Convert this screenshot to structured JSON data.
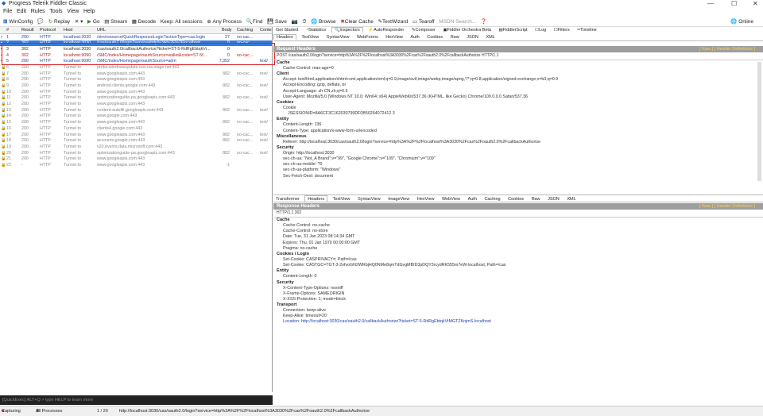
{
  "window": {
    "title": "Progress Telerik Fiddler Classic"
  },
  "menu": [
    "File",
    "Edit",
    "Rules",
    "Tools",
    "View",
    "Help"
  ],
  "toolbar": {
    "winconfig": "WinConfig",
    "replay": "Replay",
    "go": "Go",
    "stream": "Stream",
    "decode": "Decode",
    "keep": "Keep: All sessions",
    "anyprocess": "Any Process",
    "find": "Find",
    "save": "Save",
    "browse": "Browse",
    "clearcache": "Clear Cache",
    "textwizard": "TextWizard",
    "tearoff": "Tearoff",
    "msdn": "MSDN Search...",
    "online": "Online"
  },
  "columns": [
    "#",
    "Result",
    "Protocol",
    "Host",
    "URL",
    "Body",
    "Caching",
    "Conte"
  ],
  "sessions": [
    {
      "id": "1",
      "result": "200",
      "protocol": "HTTP",
      "host": "localhost:3030",
      "url": "/sim/resource/QuickResponseLogin?actionType=cas.login",
      "body": "27",
      "caching": "no-cac...",
      "content": "",
      "style": "blue"
    },
    {
      "id": "2",
      "result": "302",
      "protocol": "HTTP",
      "host": "localhost:3030",
      "url": "/cas/oauth2.0/login?service=http%3A%2F%2Flocalhost...",
      "body": "0",
      "caching": "no-cac...",
      "content": "",
      "style": "sel"
    },
    {
      "id": "3",
      "result": "302",
      "protocol": "HTTP",
      "host": "localhost:3030",
      "url": "/cas/oauth2.0/callbackAuthorize?ticket=ST-5-RdRgEbtqkVr...",
      "body": "0",
      "caching": "",
      "content": "",
      "style": ""
    },
    {
      "id": "4",
      "result": "302",
      "protocol": "HTTP",
      "host": "localhost:9090",
      "url": "/SMC/index/Homepage/oauthSource=wallet&code=ST-5f...",
      "body": "0",
      "caching": "no-cac...",
      "content": "",
      "style": "red"
    },
    {
      "id": "5",
      "result": "200",
      "protocol": "HTTP",
      "host": "localhost:9090",
      "url": "/SMC/index/Homepage/oauthSource=adm",
      "body": "7,352",
      "caching": "",
      "content": "text/",
      "style": "blue"
    },
    {
      "id": "6",
      "result": "200",
      "protocol": "HTTP",
      "host": "Tunnel to",
      "url": "probe.windowsupdate.nos.rav.stage.net:443",
      "body": "",
      "caching": "",
      "content": "",
      "style": "gray"
    },
    {
      "id": "7",
      "result": "200",
      "protocol": "HTTP",
      "host": "Tunnel to",
      "url": "www.googleapis.com:443",
      "body": "882",
      "caching": "no-cac...",
      "content": "text/",
      "style": "gray"
    },
    {
      "id": "8",
      "result": "200",
      "protocol": "HTTP",
      "host": "Tunnel to",
      "url": "www.googleapis.com:443",
      "body": "",
      "caching": "",
      "content": "",
      "style": "gray"
    },
    {
      "id": "9",
      "result": "200",
      "protocol": "HTTP",
      "host": "Tunnel to",
      "url": "android.clients.google.com:443",
      "body": "882",
      "caching": "no-cac...",
      "content": "text/",
      "style": "gray"
    },
    {
      "id": "10",
      "result": "200",
      "protocol": "HTTP",
      "host": "Tunnel to",
      "url": "www.googleapis.com:443",
      "body": "",
      "caching": "",
      "content": "",
      "style": "gray"
    },
    {
      "id": "11",
      "result": "200",
      "protocol": "HTTP",
      "host": "Tunnel to",
      "url": "optimizationguide-pa.googleapis.com:443",
      "body": "882",
      "caching": "no-cac...",
      "content": "text/",
      "style": "gray"
    },
    {
      "id": "12",
      "result": "200",
      "protocol": "HTTP",
      "host": "Tunnel to",
      "url": "www.googleapis.com:443",
      "body": "",
      "caching": "",
      "content": "",
      "style": "gray"
    },
    {
      "id": "13",
      "result": "200",
      "protocol": "HTTP",
      "host": "Tunnel to",
      "url": "content-autofill.googleapis.com:443",
      "body": "882",
      "caching": "no-cac...",
      "content": "text/",
      "style": "gray"
    },
    {
      "id": "14",
      "result": "200",
      "protocol": "HTTP",
      "host": "Tunnel to",
      "url": "www.google.com:443",
      "body": "",
      "caching": "",
      "content": "",
      "style": "gray"
    },
    {
      "id": "15",
      "result": "200",
      "protocol": "HTTP",
      "host": "Tunnel to",
      "url": "www.googleapis.com:443",
      "body": "882",
      "caching": "no-cac...",
      "content": "text/",
      "style": "gray"
    },
    {
      "id": "16",
      "result": "200",
      "protocol": "HTTP",
      "host": "Tunnel to",
      "url": "clients4.google.com:443",
      "body": "",
      "caching": "",
      "content": "",
      "style": "gray"
    },
    {
      "id": "17",
      "result": "200",
      "protocol": "HTTP",
      "host": "Tunnel to",
      "url": "www.googleapis.com:443",
      "body": "882",
      "caching": "no-cac...",
      "content": "text/",
      "style": "gray"
    },
    {
      "id": "18",
      "result": "200",
      "protocol": "HTTP",
      "host": "Tunnel to",
      "url": "accounts.google.com:443",
      "body": "882",
      "caching": "no-cac...",
      "content": "text/",
      "style": "gray"
    },
    {
      "id": "19",
      "result": "200",
      "protocol": "HTTP",
      "host": "Tunnel to",
      "url": "v20.events.data.microsoft.com:443",
      "body": "",
      "caching": "",
      "content": "",
      "style": "gray"
    },
    {
      "id": "20",
      "result": "200",
      "protocol": "HTTP",
      "host": "Tunnel to",
      "url": "optimizationguide-pa.googleapis.com:443",
      "body": "882",
      "caching": "no-cac...",
      "content": "text/",
      "style": "gray"
    },
    {
      "id": "21",
      "result": "200",
      "protocol": "HTTP",
      "host": "Tunnel to",
      "url": "www.googleapis.com:443",
      "body": "",
      "caching": "",
      "content": "",
      "style": "gray"
    },
    {
      "id": "22",
      "result": "-",
      "protocol": "HTTP",
      "host": "Tunnel to",
      "url": "www.googleapis.com:443",
      "body": "-1",
      "caching": "",
      "content": "",
      "style": "gray"
    }
  ],
  "quickexec": "[QuickExec] ALT+Q > type HELP to learn more",
  "status": {
    "capturing": "Capturing",
    "processes": "All Processes",
    "count": "1 / 20",
    "url": "http://localhost:3030/cas/oauth2.0/login?service=http%3A%2F%2Flocalhost%3A3030%2Fcas%2Foauth2.0%2FcallbackAuthorize"
  },
  "tabs_top": [
    "Get Started",
    "Statistics",
    "Inspectors",
    "AutoResponder",
    "Composer",
    "Fiddler Orchestra Beta",
    "FiddlerScript",
    "Log",
    "Filters",
    "Timeline"
  ],
  "tabs_req": [
    "Headers",
    "TextView",
    "SyntaxView",
    "WebForms",
    "HexView",
    "Auth",
    "Cookies",
    "Raw",
    "JSON",
    "XML"
  ],
  "request": {
    "header": "Request Headers",
    "links": "[ Raw ]   [ Header Definitions ]",
    "line": "POST /cas/oauth2.0/login?service=http%3A%2F%2Flocalhost%3A3030%2Fcas%2Foauth2.0%2FcallbackAuthorize HTTP/1.1",
    "sections": [
      {
        "name": "Cache",
        "items": [
          "Cache-Control: max-age=0"
        ]
      },
      {
        "name": "Client",
        "items": [
          "Accept: text/html,application/xhtml+xml,application/xml;q=0.9,image/avif,image/webp,image/apng,*/*;q=0.8,application/signed-exchange;v=b3;q=0.9",
          "Accept-Encoding: gzip, deflate, br",
          "Accept-Language: zh-CN,zh;q=0.9",
          "User-Agent: Mozilla/5.0 (Windows NT 10.0; Win64; x64) AppleWebKit/537.36 (KHTML, like Gecko) Chrome/109.0.0.0 Safari/537.36"
        ]
      },
      {
        "name": "Cookies",
        "items": [
          "Cookie"
        ],
        "sub": [
          "JSESSIONID=8A6CF3C162030799DF0B50264072412 3"
        ]
      },
      {
        "name": "Entity",
        "items": [
          "Content-Length: 136",
          "Content-Type: application/x-www-form-urlencoded"
        ]
      },
      {
        "name": "Miscellaneous",
        "items": [
          "Referer: http://localhost:3030/cas/oauth2.0/login?service=http%3A%2F%2Flocalhost%3A3030%2Fcas%2Foauth2.0%2FcallbackAuthorize"
        ]
      },
      {
        "name": "Security",
        "items": [
          "Origin: http://localhost:3030",
          "sec-ch-ua: \"Not_A Brand\";v=\"99\", \"Google Chrome\";v=\"109\", \"Chromium\";v=\"109\"",
          "sec-ch-ua-mobile: ?0",
          "sec-ch-ua-platform: \"Windows\"",
          "Sec-Fetch-Dest: document"
        ]
      }
    ]
  },
  "tabs_resp": [
    "Transformer",
    "Headers",
    "TextView",
    "SyntaxView",
    "ImageView",
    "HexView",
    "WebView",
    "Auth",
    "Caching",
    "Cookies",
    "Raw",
    "JSON",
    "XML"
  ],
  "response": {
    "header": "Response Headers",
    "links": "[ Raw ]   [ Header Definitions ]",
    "line": "HTTP/1.1 302",
    "sections": [
      {
        "name": "Cache",
        "items": [
          "Cache-Control: no-cache",
          "Cache-Control: no-store",
          "Date: Tue, 31 Jan 2023 08:14:34 GMT",
          "Expires: Thu, 01 Jan 1970 00:00:00 GMT",
          "Pragma: no-cache"
        ]
      },
      {
        "name": "Cookies / Login",
        "items": [
          "Set-Cookie: CASPRIVACY=; Path=/cas",
          "Set-Cookie: CASTGC=TGT-3-2ofvoGN2WRbjHQ0NMe8qmTdGvgMBID3pDQY3rcydRK555m7eW-localhost; Path=/cas"
        ]
      },
      {
        "name": "Entity",
        "items": [
          "Content-Length: 0"
        ]
      },
      {
        "name": "Security",
        "items": [
          "X-Content-Type-Options: nosniff",
          "X-Frame-Options: SAMEORIGIN",
          "X-XSS-Protection: 1; mode=block"
        ]
      },
      {
        "name": "Transport",
        "items": [
          "Connection: keep-alive",
          "Keep-Alive: timeout=20",
          "Location: http://localhost:3030/cas/oauth2.0/callbackAuthorize?ticket=ST-5-RdRgEbtqkVtMGTZKnjmS-localhost"
        ]
      }
    ]
  }
}
